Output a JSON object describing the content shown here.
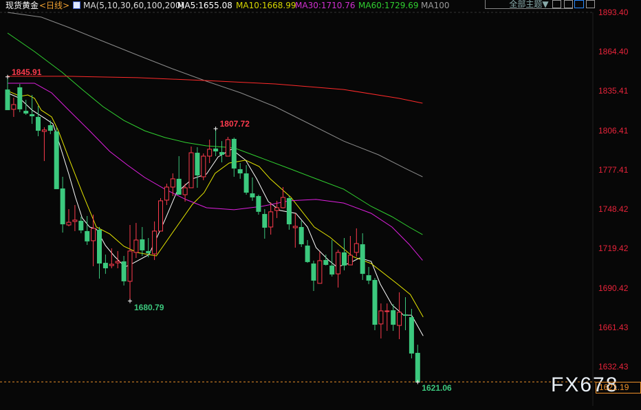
{
  "header": {
    "title": "现货黄金",
    "period": "<日线>",
    "indicator_icon": "line-chart-icon",
    "ma_params": "MA(5,10,30,60,100,200)",
    "ma5": "MA5:1655.08",
    "ma10": "MA10:1668.99",
    "ma30": "MA30:1710.76",
    "ma60": "MA60:1729.69",
    "ma100": "MA100"
  },
  "toolbar": {
    "theme_select": "全部主题▼",
    "icons": [
      "crosshair-icon",
      "range-icon",
      "play-icon",
      "expand-right-icon"
    ]
  },
  "axis": {
    "labels": [
      "1893.40",
      "1864.40",
      "1835.41",
      "1806.41",
      "1777.41",
      "1748.42",
      "1719.42",
      "1690.42",
      "1661.43",
      "1632.43"
    ],
    "values": [
      1893.4,
      1864.4,
      1835.41,
      1806.41,
      1777.41,
      1748.42,
      1719.42,
      1690.42,
      1661.43,
      1632.43
    ]
  },
  "last_price": "1621.19",
  "last_price_value": 1621.19,
  "watermark": "FX678",
  "colors": {
    "up": "#ff3b4d",
    "down": "#3cc97e",
    "ma5": "#ffffff",
    "ma10": "#e6e600",
    "ma30": "#e020e0",
    "ma60": "#30d030",
    "ma100": "#8c8c8c",
    "ma200": "#ff2a2a",
    "last": "#f0922a"
  },
  "chart_data": {
    "type": "candlestick",
    "title": "现货黄金 日线",
    "ylim": [
      1621.06,
      1893.4
    ],
    "annotations": [
      {
        "label": "1845.91",
        "index": 0,
        "price": 1845.91,
        "kind": "high"
      },
      {
        "label": "1807.72",
        "index": 34,
        "price": 1807.72,
        "kind": "high"
      },
      {
        "label": "1680.79",
        "index": 20,
        "price": 1680.79,
        "kind": "low"
      },
      {
        "label": "1621.06",
        "index": 67,
        "price": 1621.06,
        "kind": "low"
      }
    ],
    "candles": [
      [
        1836.6,
        1845.91,
        1821.4,
        1821.4
      ],
      [
        1822.0,
        1830.6,
        1816.4,
        1825.5
      ],
      [
        1838.2,
        1840.7,
        1819.9,
        1822.0
      ],
      [
        1820.9,
        1829.0,
        1817.9,
        1818.9
      ],
      [
        1818.4,
        1832.6,
        1811.3,
        1816.9
      ],
      [
        1816.4,
        1824.5,
        1802.2,
        1806.2
      ],
      [
        1805.7,
        1808.8,
        1783.9,
        1806.8
      ],
      [
        1810.3,
        1813.8,
        1803.7,
        1806.2
      ],
      [
        1805.7,
        1808.8,
        1763.2,
        1763.2
      ],
      [
        1763.7,
        1772.3,
        1731.2,
        1737.3
      ],
      [
        1736.8,
        1748.5,
        1735.8,
        1738.8
      ],
      [
        1739.4,
        1751.5,
        1732.3,
        1740.4
      ],
      [
        1739.9,
        1742.9,
        1730.7,
        1732.8
      ],
      [
        1732.3,
        1743.4,
        1722.1,
        1724.7
      ],
      [
        1725.2,
        1744.4,
        1706.4,
        1734.3
      ],
      [
        1733.3,
        1735.3,
        1697.3,
        1708.4
      ],
      [
        1708.9,
        1715.0,
        1700.8,
        1704.9
      ],
      [
        1706.9,
        1719.6,
        1704.9,
        1707.9
      ],
      [
        1708.9,
        1717.6,
        1704.9,
        1710.0
      ],
      [
        1710.0,
        1714.0,
        1692.2,
        1695.3
      ],
      [
        1695.3,
        1736.8,
        1680.79,
        1717.6
      ],
      [
        1716.6,
        1738.3,
        1712.5,
        1725.7
      ],
      [
        1726.2,
        1735.3,
        1714.0,
        1718.1
      ],
      [
        1717.6,
        1727.2,
        1713.0,
        1716.0
      ],
      [
        1715.5,
        1739.4,
        1711.0,
        1732.3
      ],
      [
        1732.3,
        1756.6,
        1732.3,
        1754.6
      ],
      [
        1755.1,
        1767.2,
        1751.5,
        1764.7
      ],
      [
        1764.7,
        1774.8,
        1758.1,
        1770.8
      ],
      [
        1770.8,
        1787.5,
        1759.1,
        1759.1
      ],
      [
        1759.1,
        1767.2,
        1754.0,
        1764.2
      ],
      [
        1764.2,
        1794.6,
        1764.2,
        1790.0
      ],
      [
        1790.0,
        1794.1,
        1764.2,
        1773.3
      ],
      [
        1772.3,
        1789.5,
        1769.8,
        1787.5
      ],
      [
        1787.5,
        1799.7,
        1782.4,
        1792.6
      ],
      [
        1793.1,
        1807.72,
        1787.5,
        1791.0
      ],
      [
        1790.5,
        1798.6,
        1782.9,
        1788.5
      ],
      [
        1787.5,
        1801.7,
        1787.5,
        1799.7
      ],
      [
        1800.2,
        1801.2,
        1772.3,
        1778.4
      ],
      [
        1777.9,
        1782.4,
        1770.8,
        1774.8
      ],
      [
        1774.8,
        1780.9,
        1759.1,
        1760.6
      ],
      [
        1760.1,
        1771.8,
        1754.6,
        1757.1
      ],
      [
        1758.1,
        1759.1,
        1744.4,
        1746.5
      ],
      [
        1744.9,
        1748.5,
        1726.7,
        1734.8
      ],
      [
        1735.3,
        1753.5,
        1729.7,
        1746.5
      ],
      [
        1747.5,
        1754.6,
        1741.9,
        1749.5
      ],
      [
        1749.5,
        1764.7,
        1749.0,
        1757.1
      ],
      [
        1756.6,
        1758.1,
        1733.3,
        1737.3
      ],
      [
        1734.8,
        1745.4,
        1720.1,
        1735.8
      ],
      [
        1735.3,
        1739.9,
        1720.6,
        1722.6
      ],
      [
        1721.6,
        1725.7,
        1708.9,
        1709.5
      ],
      [
        1708.4,
        1710.5,
        1688.2,
        1695.8
      ],
      [
        1693.8,
        1717.1,
        1693.8,
        1710.5
      ],
      [
        1711.0,
        1715.0,
        1706.9,
        1707.4
      ],
      [
        1706.9,
        1725.7,
        1698.8,
        1700.3
      ],
      [
        1700.8,
        1718.6,
        1690.7,
        1716.6
      ],
      [
        1716.6,
        1727.2,
        1703.4,
        1706.9
      ],
      [
        1707.4,
        1728.7,
        1707.4,
        1714.5
      ],
      [
        1716.6,
        1734.3,
        1713.5,
        1723.1
      ],
      [
        1722.6,
        1730.7,
        1696.3,
        1700.8
      ],
      [
        1699.8,
        1705.9,
        1693.2,
        1695.8
      ],
      [
        1696.3,
        1697.8,
        1659.3,
        1663.3
      ],
      [
        1663.9,
        1679.0,
        1653.2,
        1673.5
      ],
      [
        1673.0,
        1679.0,
        1658.8,
        1673.5
      ],
      [
        1674.0,
        1678.5,
        1658.8,
        1663.3
      ],
      [
        1662.8,
        1687.2,
        1652.7,
        1672.5
      ],
      [
        1670.9,
        1683.6,
        1659.3,
        1669.9
      ],
      [
        1668.9,
        1675.0,
        1638.5,
        1642.1
      ],
      [
        1642.6,
        1648.6,
        1621.06,
        1621.19
      ]
    ],
    "candle_fields": [
      "open",
      "high",
      "low",
      "close"
    ],
    "ma_series": [
      {
        "name": "MA5",
        "color_key": "ma5",
        "points": [
          [
            0,
            1834.1
          ],
          [
            2,
            1830.1
          ],
          [
            4,
            1821.4
          ],
          [
            6.1,
            1815.3
          ],
          [
            7.4,
            1811.3
          ],
          [
            8.5,
            1796.1
          ],
          [
            10,
            1774.3
          ],
          [
            11.1,
            1757.1
          ],
          [
            12.2,
            1741.9
          ],
          [
            13.4,
            1735.3
          ],
          [
            14.5,
            1733.8
          ],
          [
            16,
            1721.6
          ],
          [
            17.5,
            1713.5
          ],
          [
            19.2,
            1705.9
          ],
          [
            20.4,
            1708.4
          ],
          [
            23.1,
            1715.0
          ],
          [
            25.7,
            1740.4
          ],
          [
            27.6,
            1760.6
          ],
          [
            30.2,
            1770.8
          ],
          [
            32.5,
            1774.3
          ],
          [
            34.4,
            1787.0
          ],
          [
            36.6,
            1792.6
          ],
          [
            38.9,
            1784.5
          ],
          [
            40.7,
            1770.8
          ],
          [
            42.6,
            1754.0
          ],
          [
            44.5,
            1747.5
          ],
          [
            47.1,
            1745.4
          ],
          [
            49,
            1735.3
          ],
          [
            50.4,
            1720.1
          ],
          [
            52.4,
            1711.0
          ],
          [
            53.8,
            1705.9
          ],
          [
            55.7,
            1708.4
          ],
          [
            57.5,
            1712.5
          ],
          [
            59.4,
            1710.0
          ],
          [
            60.9,
            1693.2
          ],
          [
            62.8,
            1678.0
          ],
          [
            64.7,
            1670.4
          ],
          [
            66,
            1670.4
          ],
          [
            67.9,
            1655.08
          ]
        ]
      },
      {
        "name": "MA10",
        "color_key": "ma10",
        "points": [
          [
            0,
            1835.6
          ],
          [
            2.1,
            1831.6
          ],
          [
            3.3,
            1832.6
          ],
          [
            4.4,
            1830.1
          ],
          [
            5.5,
            1821.4
          ],
          [
            7.2,
            1816.4
          ],
          [
            8.3,
            1806.2
          ],
          [
            10,
            1786.0
          ],
          [
            12.2,
            1760.6
          ],
          [
            14.5,
            1735.3
          ],
          [
            16.7,
            1730.2
          ],
          [
            19,
            1721.1
          ],
          [
            21.2,
            1716.5
          ],
          [
            24.3,
            1714.0
          ],
          [
            27.6,
            1735.3
          ],
          [
            30.2,
            1752.0
          ],
          [
            32.1,
            1760.6
          ],
          [
            33.9,
            1774.8
          ],
          [
            36.2,
            1782.4
          ],
          [
            38.9,
            1784.5
          ],
          [
            41.1,
            1779.9
          ],
          [
            42.9,
            1770.8
          ],
          [
            46.3,
            1757.1
          ],
          [
            50.1,
            1735.3
          ],
          [
            52.7,
            1727.7
          ],
          [
            56.4,
            1713.5
          ],
          [
            59.4,
            1708.4
          ],
          [
            63.6,
            1693.7
          ],
          [
            65.8,
            1685.6
          ],
          [
            67.9,
            1668.99
          ]
        ]
      },
      {
        "name": "MA30",
        "color_key": "ma30",
        "points": [
          [
            0,
            1841.2
          ],
          [
            4.4,
            1841.2
          ],
          [
            7.2,
            1834.1
          ],
          [
            10,
            1821.4
          ],
          [
            13.4,
            1806.2
          ],
          [
            16.7,
            1791.0
          ],
          [
            19.6,
            1780.9
          ],
          [
            22.4,
            1771.8
          ],
          [
            25.7,
            1763.2
          ],
          [
            29.1,
            1755.6
          ],
          [
            32.5,
            1749.5
          ],
          [
            37,
            1748.0
          ],
          [
            41.5,
            1750.5
          ],
          [
            46,
            1754.6
          ],
          [
            50.4,
            1755.6
          ],
          [
            54.9,
            1753.0
          ],
          [
            59.4,
            1745.4
          ],
          [
            62.8,
            1735.3
          ],
          [
            65.6,
            1722.6
          ],
          [
            67.8,
            1710.76
          ]
        ]
      },
      {
        "name": "MA60",
        "color_key": "ma60",
        "points": [
          [
            0,
            1878.2
          ],
          [
            4.4,
            1864.5
          ],
          [
            8.9,
            1849.3
          ],
          [
            12.2,
            1836.6
          ],
          [
            15.6,
            1824.0
          ],
          [
            19,
            1813.8
          ],
          [
            22.4,
            1806.2
          ],
          [
            25.7,
            1801.2
          ],
          [
            29.1,
            1797.6
          ],
          [
            32.5,
            1795.1
          ],
          [
            37,
            1793.6
          ],
          [
            41.5,
            1786.0
          ],
          [
            46,
            1778.4
          ],
          [
            50.4,
            1770.8
          ],
          [
            54.9,
            1763.2
          ],
          [
            59.4,
            1750.5
          ],
          [
            62.8,
            1742.9
          ],
          [
            65.6,
            1735.3
          ],
          [
            67.8,
            1729.69
          ]
        ]
      },
      {
        "name": "MA100",
        "color_key": "ma100",
        "points": [
          [
            0,
            1893.4
          ],
          [
            5.5,
            1889.9
          ],
          [
            10,
            1882.3
          ],
          [
            15.6,
            1872.1
          ],
          [
            21.2,
            1862.0
          ],
          [
            26.9,
            1851.9
          ],
          [
            32.5,
            1842.7
          ],
          [
            38.1,
            1834.1
          ],
          [
            43.7,
            1824.0
          ],
          [
            49.3,
            1811.3
          ],
          [
            54.9,
            1798.6
          ],
          [
            60.6,
            1788.5
          ],
          [
            65,
            1778.4
          ],
          [
            67.8,
            1772.3
          ]
        ]
      },
      {
        "name": "MA200",
        "color_key": "ma200",
        "points": [
          [
            0,
            1846.3
          ],
          [
            10,
            1846.3
          ],
          [
            21.2,
            1845.3
          ],
          [
            32.5,
            1843.2
          ],
          [
            43.7,
            1840.7
          ],
          [
            54.9,
            1836.6
          ],
          [
            63.9,
            1830.1
          ],
          [
            67.8,
            1826.5
          ]
        ]
      }
    ]
  }
}
